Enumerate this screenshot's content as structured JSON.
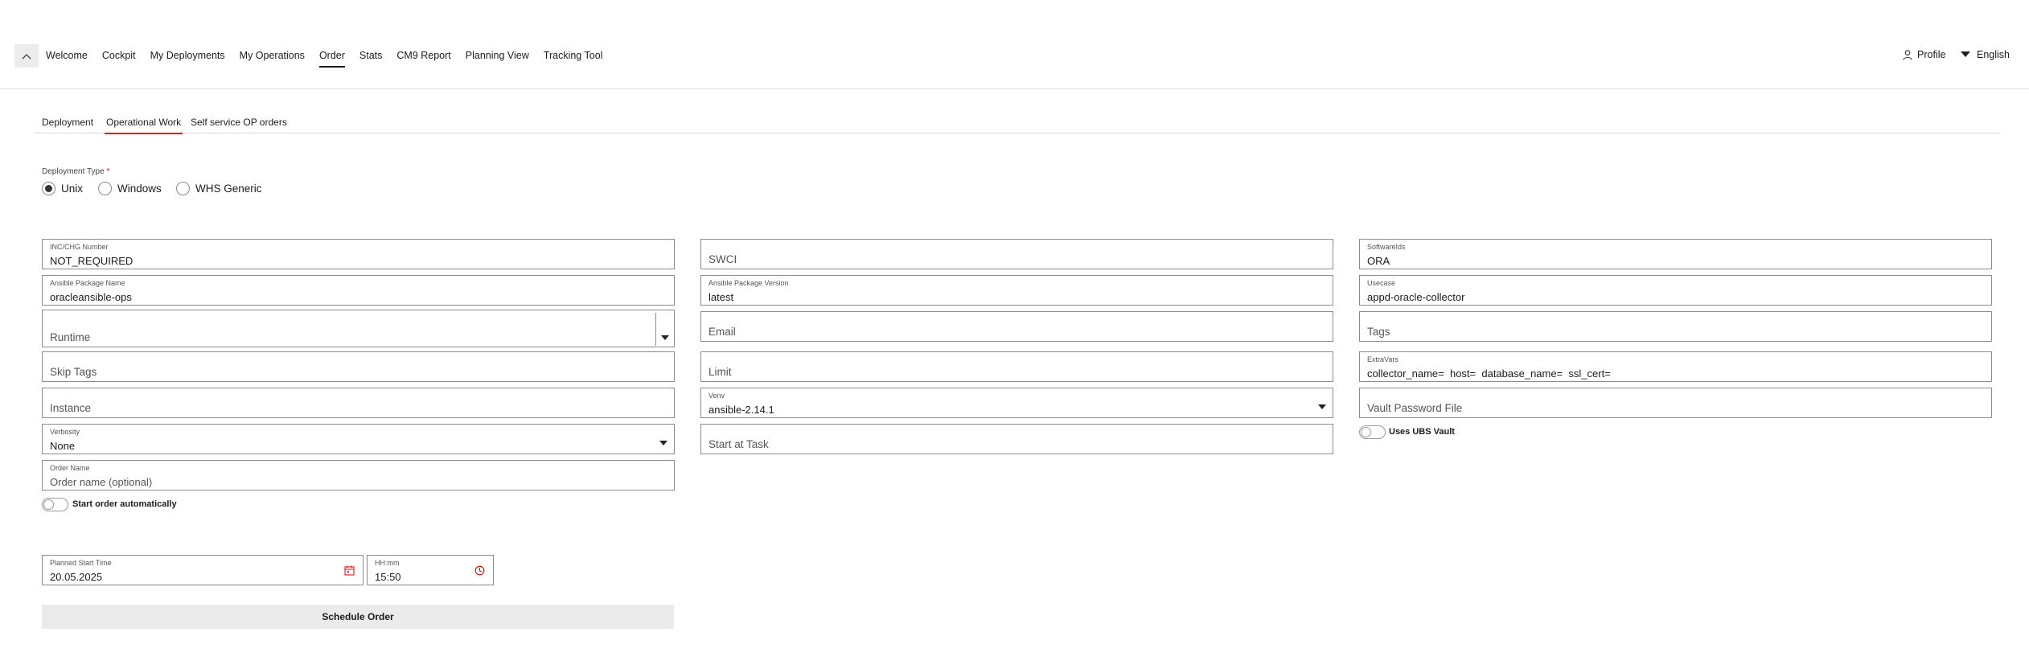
{
  "nav": {
    "items": [
      {
        "label": "Welcome"
      },
      {
        "label": "Cockpit"
      },
      {
        "label": "My Deployments"
      },
      {
        "label": "My Operations"
      },
      {
        "label": "Order",
        "active": true
      },
      {
        "label": "Stats"
      },
      {
        "label": "CM9 Report"
      },
      {
        "label": "Planning View"
      },
      {
        "label": "Tracking Tool"
      }
    ],
    "profile_label": "Profile",
    "language_label": "English"
  },
  "subtabs": [
    {
      "label": "Deployment"
    },
    {
      "label": "Operational Work",
      "active": true
    },
    {
      "label": "Self service OP orders"
    }
  ],
  "deployment_type": {
    "label": "Deployment Type",
    "required_mark": "*",
    "options": [
      "Unix",
      "Windows",
      "WHS Generic"
    ],
    "selected": "Unix"
  },
  "form": {
    "inc_chg": {
      "label": "INC/CHG Number",
      "value": "NOT_REQUIRED"
    },
    "swci": {
      "placeholder": "SWCI"
    },
    "software_ids": {
      "label": "SoftwareIds",
      "value": "ORA"
    },
    "package_name": {
      "label": "Ansible Package Name",
      "value": "oracleansible-ops"
    },
    "package_version": {
      "label": "Ansible Package Version",
      "value": "latest"
    },
    "usecase": {
      "label": "Usecase",
      "value": "appd-oracle-collector"
    },
    "runtime": {
      "placeholder": "Runtime"
    },
    "email": {
      "placeholder": "Email"
    },
    "tags": {
      "placeholder": "Tags"
    },
    "skip_tags": {
      "placeholder": "Skip Tags"
    },
    "limit": {
      "placeholder": "Limit"
    },
    "extra_vars": {
      "label": "ExtraVars",
      "value": "collector_name=  host=  database_name=  ssl_cert="
    },
    "instance": {
      "placeholder": "Instance"
    },
    "venv": {
      "label": "Venv",
      "value": "ansible-2.14.1"
    },
    "vault_password_file": {
      "placeholder": "Vault Password File"
    },
    "uses_ubs_vault": {
      "label": "Uses UBS Vault",
      "checked": false
    },
    "verbosity": {
      "label": "Verbosity",
      "value": "None"
    },
    "start_at_task": {
      "placeholder": "Start at Task"
    },
    "order_name": {
      "label": "Order Name",
      "placeholder": "Order name (optional)"
    },
    "start_automatically": {
      "label": "Start order automatically",
      "checked": false
    },
    "planned_start": {
      "label": "Planned Start Time",
      "value": "20.05.2025"
    },
    "time": {
      "label": "HH:mm",
      "value": "15:50"
    },
    "schedule_button": "Schedule Order"
  },
  "colors": {
    "accent": "#e60000",
    "border": "#8c8c8c",
    "button_bg": "#ebebeb"
  }
}
